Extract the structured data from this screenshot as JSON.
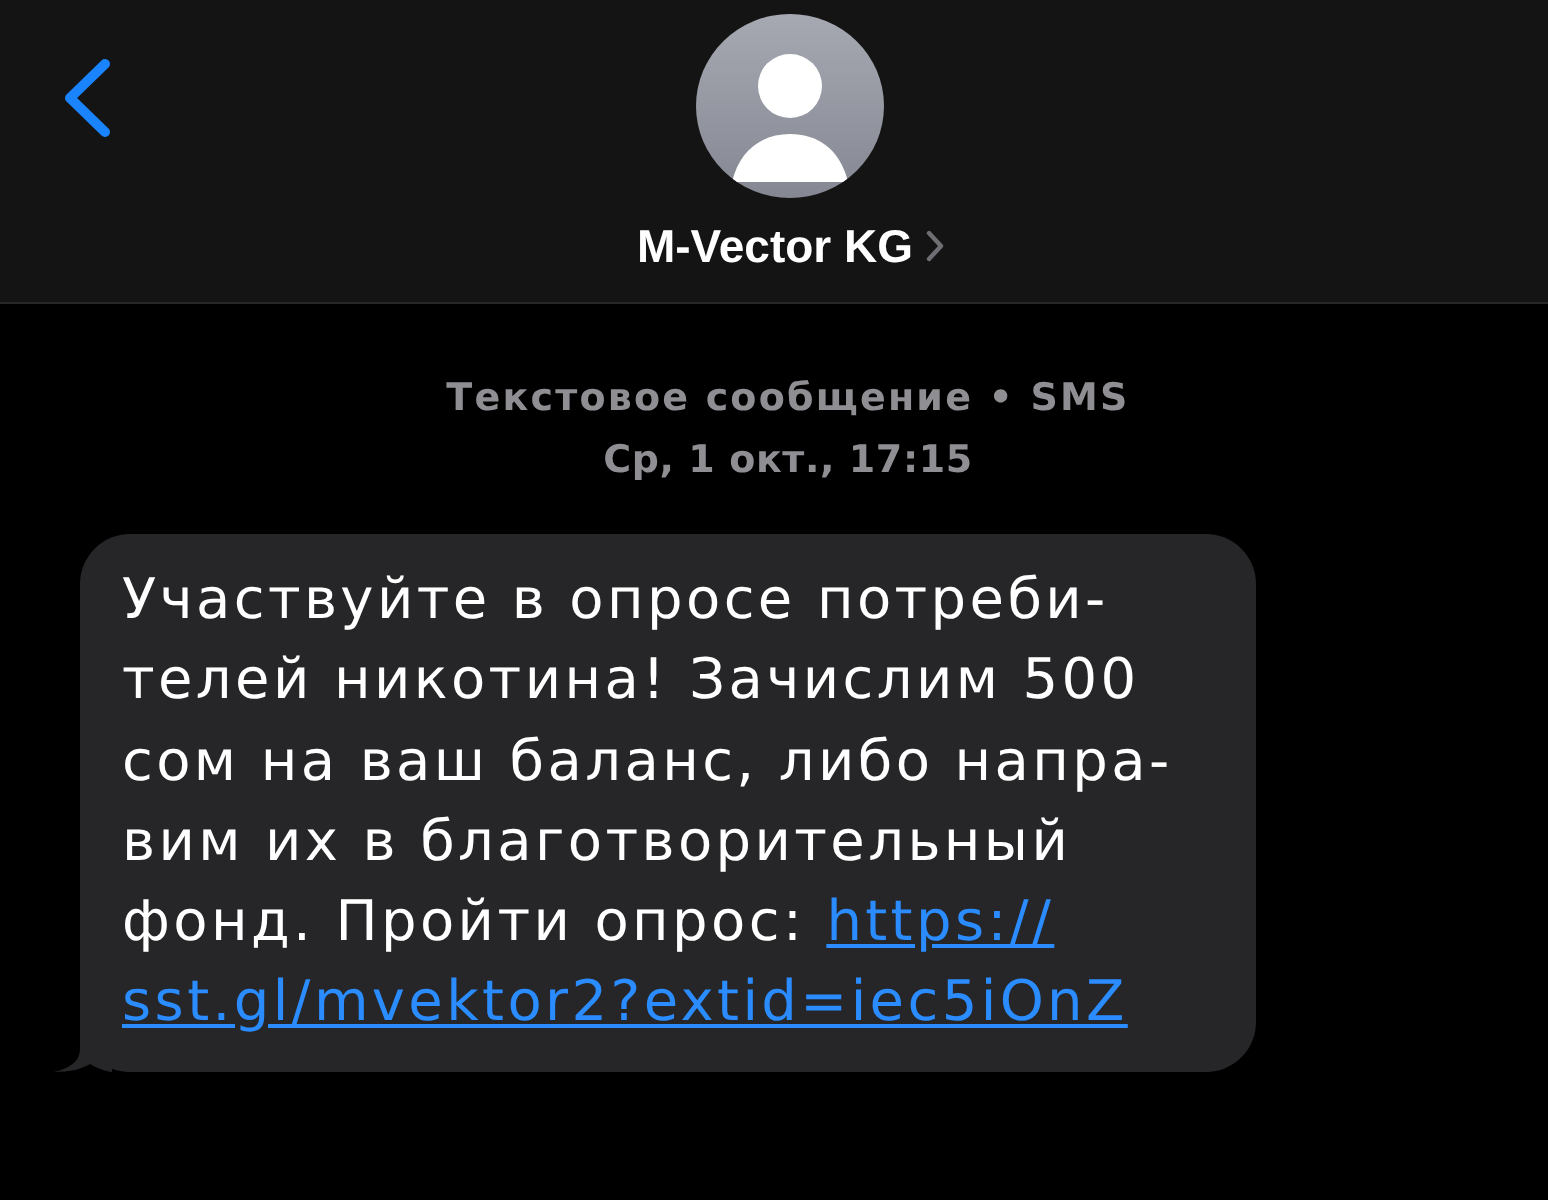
{
  "header": {
    "contact_name": "M-Vector KG"
  },
  "meta": {
    "service": "Текстовое сообщение • SMS",
    "timestamp": "Ср, 1 окт., 17:15"
  },
  "message": {
    "text_lines": [
      "Участвуйте в опросе потреби-",
      "телей никотина! Зачислим 500",
      "сом на ваш баланс, либо напра-",
      "вим их в благотворительный",
      "фонд. Пройти опрос:"
    ],
    "link": [
      "https://",
      "sst.gl/mvektor2?extid=iec5iOnZ"
    ]
  }
}
